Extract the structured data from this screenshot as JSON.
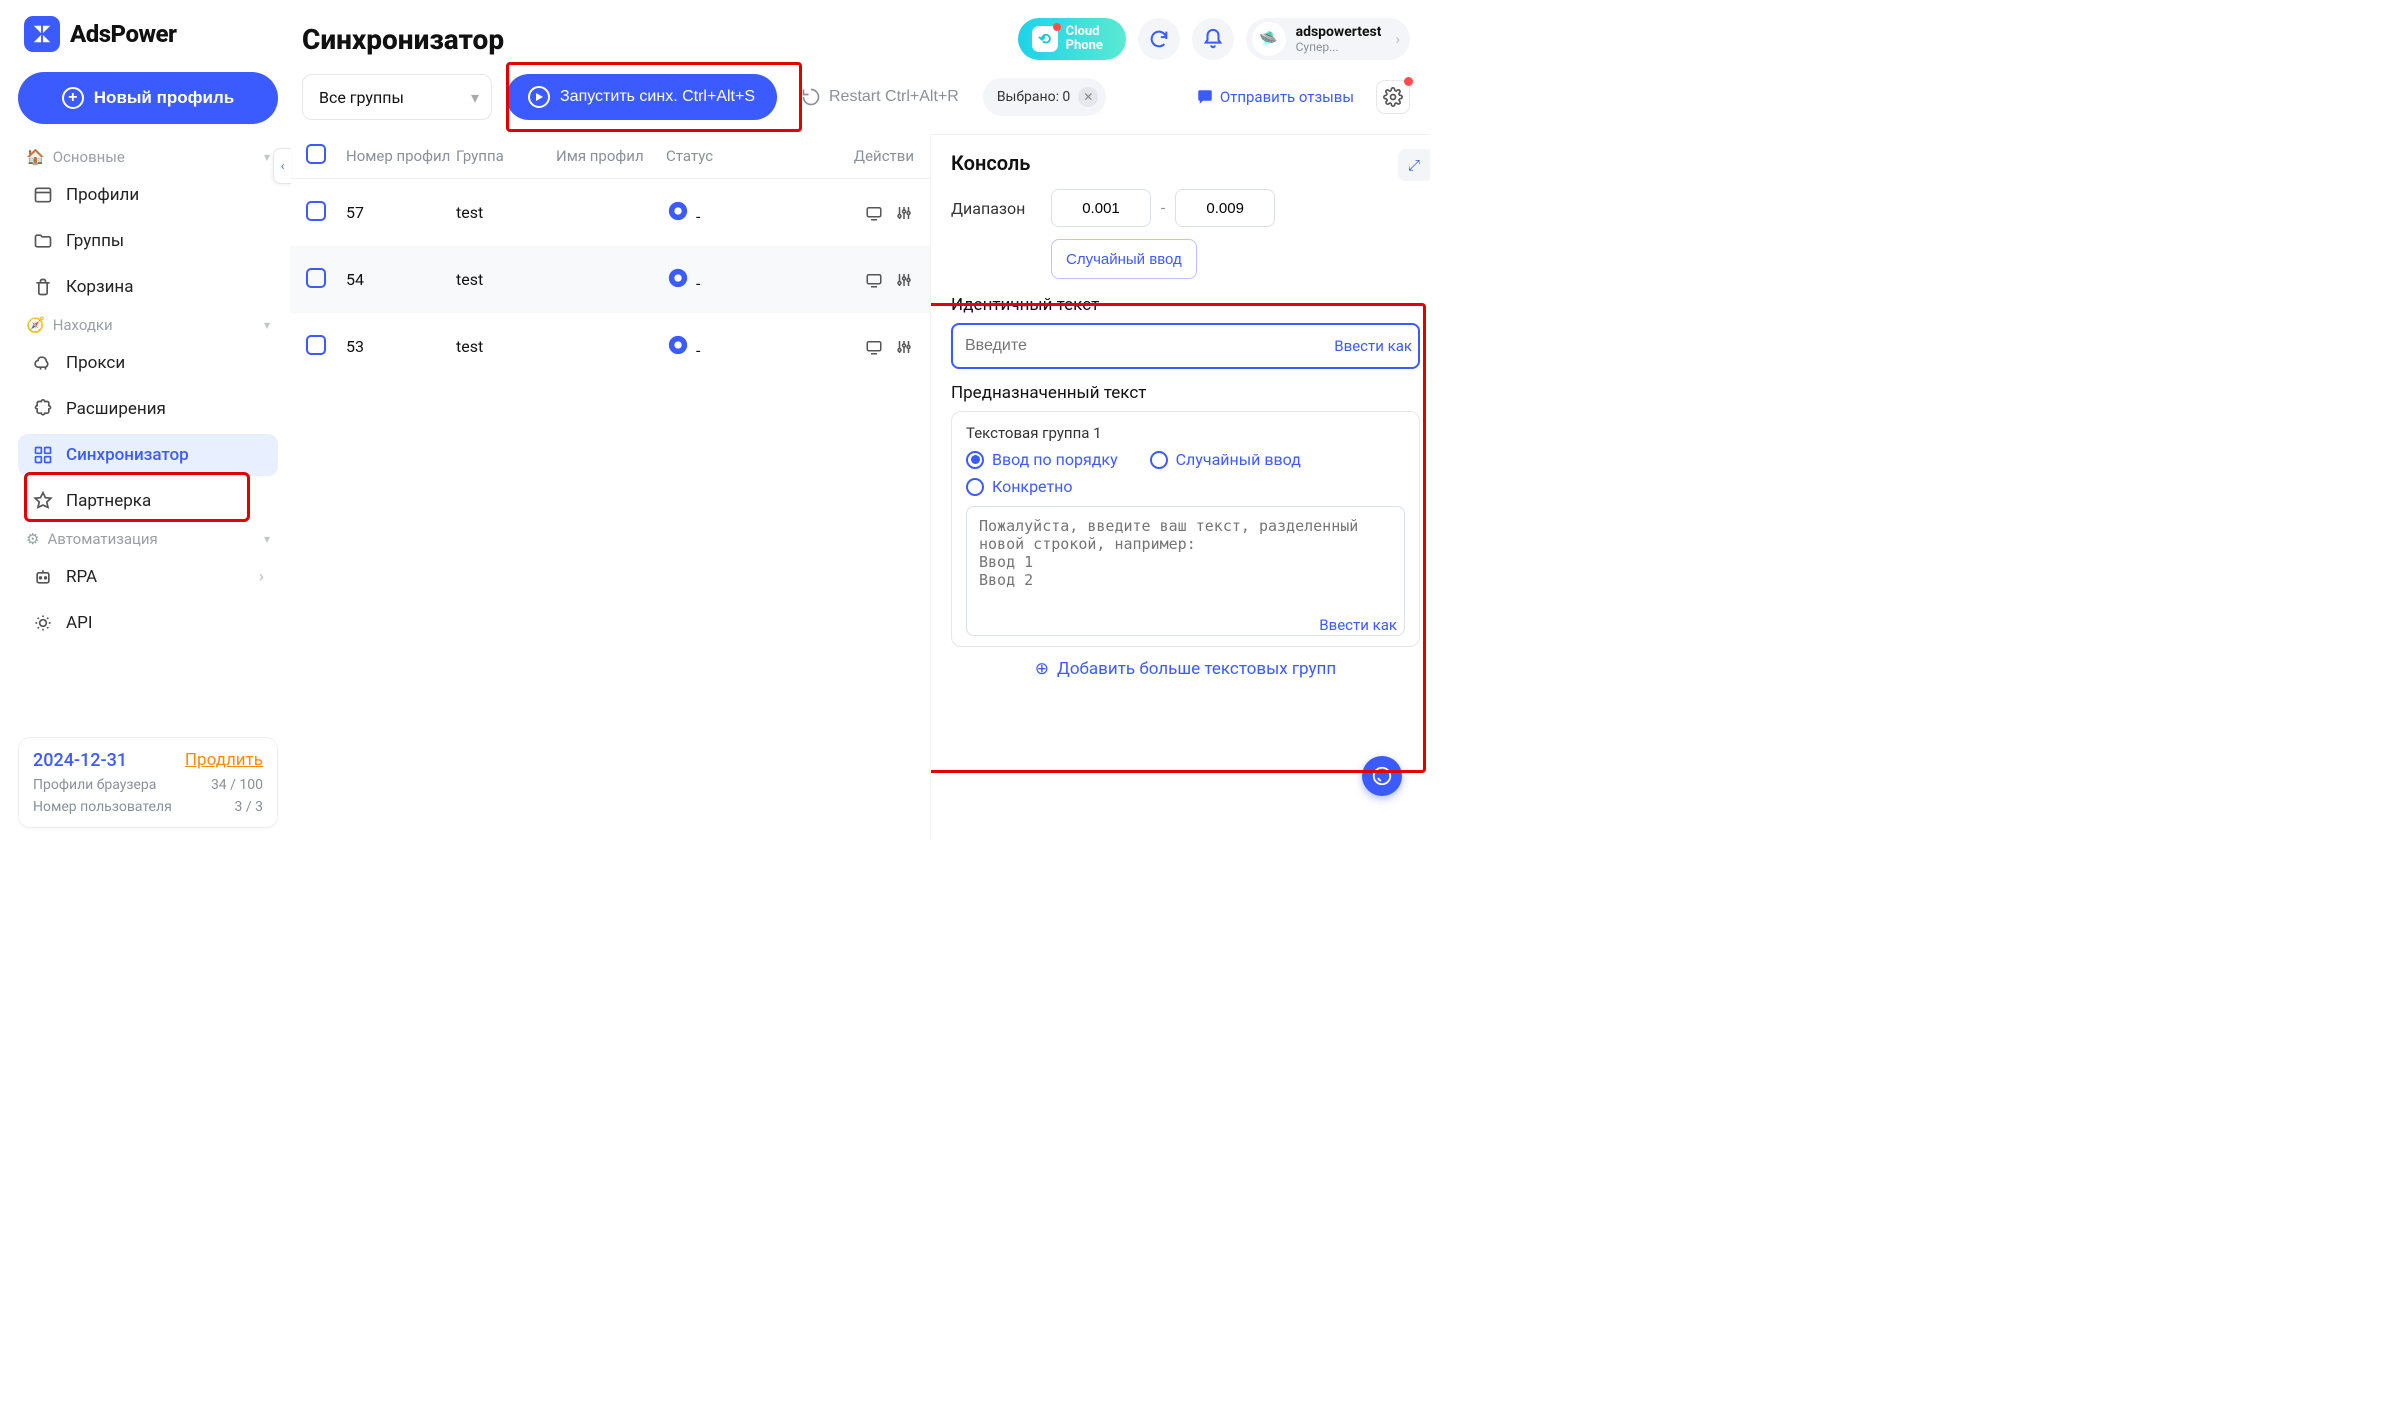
{
  "app": {
    "name": "AdsPower"
  },
  "sidebar": {
    "new_profile": "Новый профиль",
    "sections": {
      "main": "Основные",
      "finds": "Находки",
      "automation": "Автоматизация"
    },
    "items": {
      "profiles": "Профили",
      "groups": "Группы",
      "trash": "Корзина",
      "proxy": "Прокси",
      "extensions": "Расширения",
      "synchronizer": "Синхронизатор",
      "partner": "Партнерка",
      "rpa": "RPA",
      "api": "API"
    },
    "sub": {
      "date": "2024-12-31",
      "extend": "Продлить",
      "stat1_label": "Профили браузера",
      "stat1_value": "34 / 100",
      "stat2_label": "Номер пользователя",
      "stat2_value": "3 / 3"
    }
  },
  "header": {
    "title": "Синхронизатор",
    "cloud_phone": "Cloud Phone",
    "user": {
      "name": "adspowertest",
      "plan": "Супер..."
    }
  },
  "toolbar": {
    "group_filter": "Все группы",
    "start_sync": "Запустить синх. Ctrl+Alt+S",
    "restart": "Restart Ctrl+Alt+R",
    "selected_label": "Выбрано: 0",
    "feedback": "Отправить отзывы"
  },
  "table": {
    "headers": {
      "number": "Номер профил",
      "group": "Группа",
      "name": "Имя профил",
      "status": "Статус",
      "actions": "Действи"
    },
    "rows": [
      {
        "number": "57",
        "group": "test",
        "name": "",
        "status": "-"
      },
      {
        "number": "54",
        "group": "test",
        "name": "",
        "status": "-"
      },
      {
        "number": "53",
        "group": "test",
        "name": "",
        "status": "-"
      }
    ]
  },
  "panel": {
    "title": "Консоль",
    "range_label": "Диапазон",
    "range_from": "0.001",
    "range_to": "0.009",
    "random_btn": "Случайный ввод",
    "identical_title": "Идентичный текст",
    "identical_placeholder": "Введите",
    "identical_suffix": "Ввести как",
    "designated_title": "Предназначенный текст",
    "group_label": "Текстовая группа 1",
    "radios": {
      "order": "Ввод по порядку",
      "random": "Случайный ввод",
      "concrete": "Конкретно"
    },
    "textarea_placeholder": "Пожалуйста, введите ваш текст, разделенный новой строкой, например:\nВвод 1\nВвод 2",
    "textarea_suffix": "Ввести как",
    "add_more": "Добавить больше текстовых групп"
  }
}
